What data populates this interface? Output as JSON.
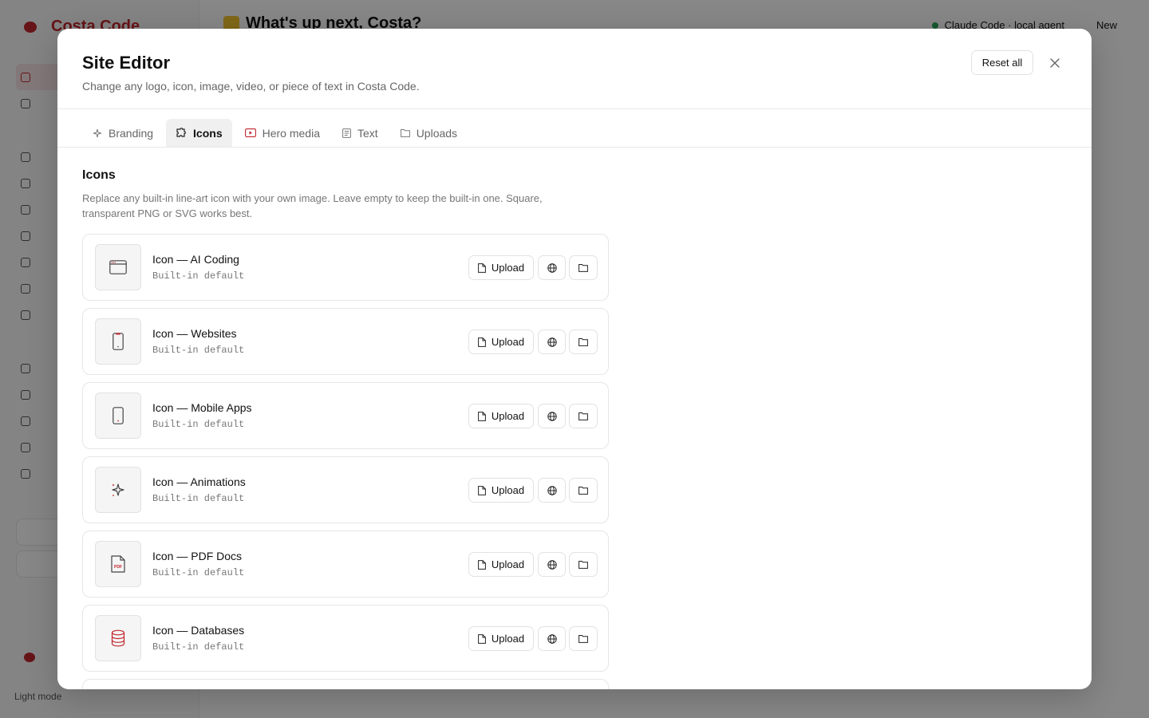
{
  "background": {
    "app_name": "Costa Code",
    "greeting": "What's up next, Costa?",
    "model_status": "Claude Code · local agent",
    "new_label": "New",
    "footer_mode": "Light mode"
  },
  "modal": {
    "title": "Site Editor",
    "subtitle": "Change any logo, icon, image, video, or piece of text in Costa Code.",
    "reset_label": "Reset all",
    "tabs": [
      {
        "label": "Branding",
        "icon": "sparkle-icon",
        "active": false
      },
      {
        "label": "Icons",
        "icon": "puzzle-icon",
        "active": true
      },
      {
        "label": "Hero media",
        "icon": "video-icon",
        "active": false
      },
      {
        "label": "Text",
        "icon": "document-icon",
        "active": false
      },
      {
        "label": "Uploads",
        "icon": "folder-icon",
        "active": false
      }
    ],
    "section": {
      "title": "Icons",
      "description": "Replace any built-in line-art icon with your own image. Leave empty to keep the built-in one. Square, transparent PNG or SVG works best."
    },
    "upload_label": "Upload",
    "rows": [
      {
        "label": "Icon — AI Coding",
        "status": "Built-in default",
        "icon": "browser-window-icon"
      },
      {
        "label": "Icon — Websites",
        "status": "Built-in default",
        "icon": "phone-notch-icon"
      },
      {
        "label": "Icon — Mobile Apps",
        "status": "Built-in default",
        "icon": "mobile-phone-icon"
      },
      {
        "label": "Icon — Animations",
        "status": "Built-in default",
        "icon": "sparkle-icon"
      },
      {
        "label": "Icon — PDF Docs",
        "status": "Built-in default",
        "icon": "pdf-file-icon"
      },
      {
        "label": "Icon — Databases",
        "status": "Built-in default",
        "icon": "database-icon"
      }
    ]
  },
  "colors": {
    "accent": "#c0262d",
    "overlay": "rgba(0,0,0,0.47)",
    "active_tab_bg": "#f0f0f0"
  }
}
